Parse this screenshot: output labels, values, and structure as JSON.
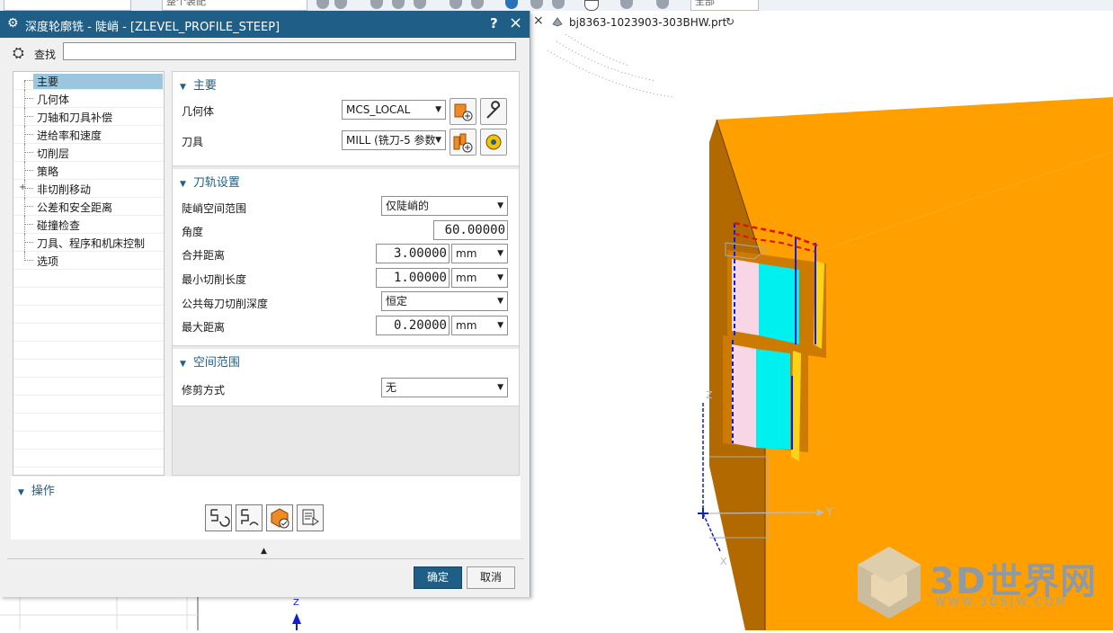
{
  "toolbar": {
    "combo1": "",
    "combo2": "整个装配",
    "combo3": "全部"
  },
  "tab": {
    "close": "×",
    "title": "bj8363-1023903-303BHW.prt",
    "pin": "↻"
  },
  "dialog": {
    "title": "深度轮廓铣 - 陡峭 - [ZLEVEL_PROFILE_STEEP]",
    "help": "?",
    "close": "×",
    "find_label": "查找",
    "find_value": ""
  },
  "tree": {
    "items": [
      {
        "label": "主要"
      },
      {
        "label": "几何体"
      },
      {
        "label": "刀轴和刀具补偿"
      },
      {
        "label": "进给率和速度"
      },
      {
        "label": "切削层"
      },
      {
        "label": "策略"
      },
      {
        "label": "非切削移动"
      },
      {
        "label": "公差和安全距离"
      },
      {
        "label": "碰撞检查"
      },
      {
        "label": "刀具、程序和机床控制"
      },
      {
        "label": "选项"
      }
    ]
  },
  "main_group": {
    "header": "主要",
    "geometry_label": "几何体",
    "geometry_value": "MCS_LOCAL",
    "tool_label": "刀具",
    "tool_value": "MILL (铣刀-5 参数"
  },
  "path_group": {
    "header": "刀轨设置",
    "steep_label": "陡峭空间范围",
    "steep_value": "仅陡峭的",
    "angle_label": "角度",
    "angle_value": "60.00000",
    "merge_label": "合并距离",
    "merge_value": "3.00000",
    "merge_unit": "mm",
    "minlen_label": "最小切削长度",
    "minlen_value": "1.00000",
    "minlen_unit": "mm",
    "depth_label": "公共每刀切削深度",
    "depth_value": "恒定",
    "maxdist_label": "最大距离",
    "maxdist_value": "0.20000",
    "maxdist_unit": "mm"
  },
  "space_group": {
    "header": "空间范围",
    "trim_label": "修剪方式",
    "trim_value": "无"
  },
  "ops_group": {
    "header": "操作"
  },
  "buttons": {
    "ok": "确定",
    "cancel": "取消"
  },
  "viewport": {
    "axis_y": "Y",
    "axis_z": "Z",
    "axis_x": "X",
    "axis_z2": "Z"
  },
  "watermark": {
    "text": "3D世界网",
    "sub": "WWW.3DSJW.COM"
  },
  "colors": {
    "titlebar": "#1f5f87",
    "selection": "#9cc6dd",
    "part_orange": "#ff9f00",
    "part_cyan": "#00f0f0",
    "toolpath_blue": "#1020d0",
    "toolpath_red": "#e01010"
  }
}
